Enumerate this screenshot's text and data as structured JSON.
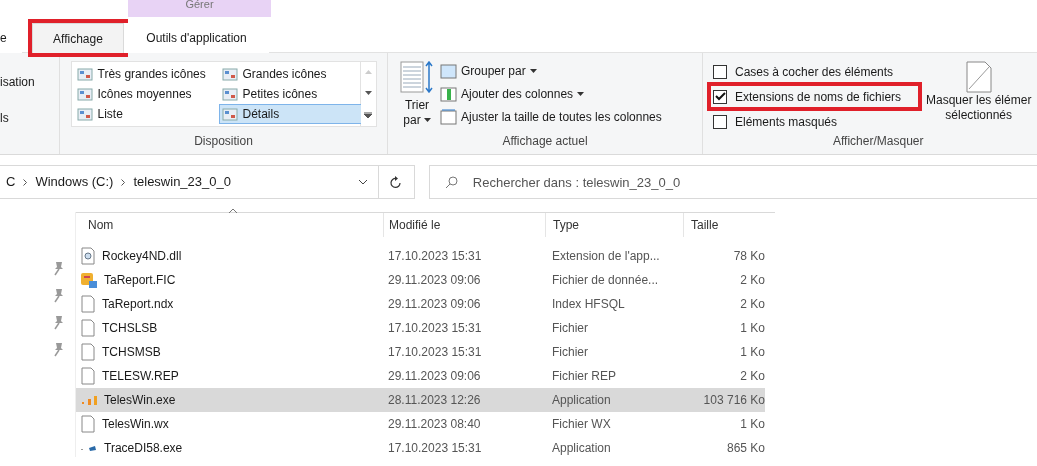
{
  "contextual_group": "Gérer",
  "tabs": [
    {
      "label": "e",
      "selected": false,
      "highlighted": false
    },
    {
      "label": "Affichage",
      "selected": true,
      "highlighted": true
    },
    {
      "label": "Outils d'application",
      "selected": false,
      "highlighted": false
    }
  ],
  "ribbon": {
    "left_items": [
      "isation",
      "ls"
    ],
    "layout": {
      "title": "Disposition",
      "options": [
        {
          "label": "Très grandes icônes",
          "selected": false
        },
        {
          "label": "Grandes icônes",
          "selected": false
        },
        {
          "label": "Icônes moyennes",
          "selected": false
        },
        {
          "label": "Petites icônes",
          "selected": false
        },
        {
          "label": "Liste",
          "selected": false
        },
        {
          "label": "Détails",
          "selected": true
        }
      ]
    },
    "current_view": {
      "title": "Affichage actuel",
      "sort_label": "Trier",
      "sort_label_2": "par",
      "commands": [
        "Grouper par",
        "Ajouter des colonnes",
        "Ajuster la taille de toutes les colonnes"
      ]
    },
    "show_hide": {
      "title": "Afficher/Masquer",
      "checkboxes": [
        {
          "label": "Cases à cocher des éléments",
          "checked": false,
          "highlighted": false
        },
        {
          "label": "Extensions de noms de fichiers",
          "checked": true,
          "highlighted": true
        },
        {
          "label": "Eléments masqués",
          "checked": false,
          "highlighted": false
        }
      ],
      "hide_selected": [
        "Masquer les élémer",
        "sélectionnés"
      ]
    }
  },
  "address": {
    "crumbs": [
      "C",
      "Windows (C:)",
      "teleswin_23_0_0"
    ],
    "search_placeholder": "Rechercher dans : teleswin_23_0_0"
  },
  "table": {
    "columns": [
      "Nom",
      "Modifié le",
      "Type",
      "Taille"
    ],
    "rows": [
      {
        "name": "Rockey4ND.dll",
        "modified": "17.10.2023 15:31",
        "type": "Extension de l'app...",
        "size": "78 Ko",
        "kind": "dll",
        "selected": false
      },
      {
        "name": "TaReport.FIC",
        "modified": "29.11.2023 09:06",
        "type": "Fichier de donnée...",
        "size": "2 Ko",
        "kind": "database",
        "selected": false
      },
      {
        "name": "TaReport.ndx",
        "modified": "29.11.2023 09:06",
        "type": "Index HFSQL",
        "size": "2 Ko",
        "kind": "file",
        "selected": false
      },
      {
        "name": "TCHSLSB",
        "modified": "17.10.2023 15:31",
        "type": "Fichier",
        "size": "1 Ko",
        "kind": "file",
        "selected": false
      },
      {
        "name": "TCHSMSB",
        "modified": "17.10.2023 15:31",
        "type": "Fichier",
        "size": "1 Ko",
        "kind": "file",
        "selected": false
      },
      {
        "name": "TELESW.REP",
        "modified": "29.11.2023 09:06",
        "type": "Fichier REP",
        "size": "2 Ko",
        "kind": "file",
        "selected": false
      },
      {
        "name": "TelesWin.exe",
        "modified": "28.11.2023 12:26",
        "type": "Application",
        "size": "103 716 Ko",
        "kind": "app",
        "selected": true
      },
      {
        "name": "TelesWin.wx",
        "modified": "29.11.2023 08:40",
        "type": "Fichier WX",
        "size": "1 Ko",
        "kind": "file",
        "selected": false
      },
      {
        "name": "TraceDI58.exe",
        "modified": "17.10.2023 15:31",
        "type": "Application",
        "size": "865 Ko",
        "kind": "tool",
        "selected": false
      }
    ]
  }
}
